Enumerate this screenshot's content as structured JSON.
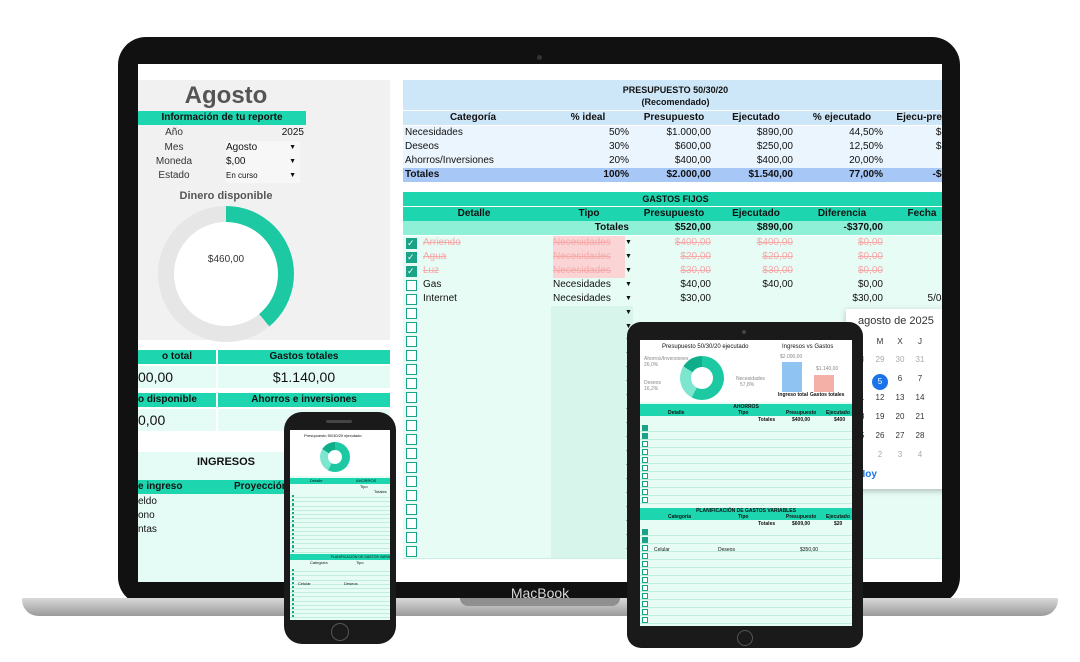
{
  "device": {
    "laptop_label": "MacBook"
  },
  "summary": {
    "month": "Agosto",
    "info_title": "Información de tu reporte",
    "fields": [
      {
        "label": "Año",
        "value": "2025"
      },
      {
        "label": "Mes",
        "value": "Agosto"
      },
      {
        "label": "Moneda",
        "value": "$,00"
      },
      {
        "label": "Estado",
        "value": "En curso"
      }
    ],
    "dinero_title": "Dinero disponible",
    "dinero_value": "$460,00",
    "dinero_fraction": 0.39,
    "kpis": [
      {
        "label": "o total",
        "value": "00,00"
      },
      {
        "label": "Gastos totales",
        "value": "$1.140,00"
      },
      {
        "label": "o disponible",
        "value": "0,00"
      },
      {
        "label": "Ahorros e inversiones",
        "value": "$"
      }
    ]
  },
  "ingresos": {
    "title": "INGRESOS",
    "col1": "e ingreso",
    "col2": "Proyección",
    "rows": [
      "eldo",
      "ono",
      "ntas"
    ]
  },
  "presupuesto": {
    "title": "PRESUPUESTO 50/30/20",
    "subtitle": "(Recomendado)",
    "headers": [
      "Categoría",
      "% ideal",
      "Presupuesto",
      "Ejecutado",
      "% ejecutado",
      "Ejecu-pres"
    ],
    "rows": [
      {
        "cat": "Necesidades",
        "ideal": "50%",
        "pres": "$1.000,00",
        "ejec": "$890,00",
        "pct": "44,50%",
        "diff": "$1"
      },
      {
        "cat": "Deseos",
        "ideal": "30%",
        "pres": "$600,00",
        "ejec": "$250,00",
        "pct": "12,50%",
        "diff": "$3"
      },
      {
        "cat": "Ahorros/Inversiones",
        "ideal": "20%",
        "pres": "$400,00",
        "ejec": "$400,00",
        "pct": "20,00%",
        "diff": ""
      }
    ],
    "totals": {
      "cat": "Totales",
      "ideal": "100%",
      "pres": "$2.000,00",
      "ejec": "$1.540,00",
      "pct": "77,00%",
      "diff": "-$4"
    }
  },
  "gastos_fijos": {
    "title": "GASTOS FIJOS",
    "headers": [
      "Detalle",
      "Tipo",
      "Presupuesto",
      "Ejecutado",
      "Diferencia",
      "Fecha"
    ],
    "totals": {
      "label": "Totales",
      "pres": "$520,00",
      "ejec": "$890,00",
      "diff": "-$370,00"
    },
    "rows": [
      {
        "checked": true,
        "detalle": "Arriendo",
        "tipo": "Necesidades",
        "pres": "$400,00",
        "ejec": "$400,00",
        "diff": "$0,00",
        "fecha": ""
      },
      {
        "checked": true,
        "detalle": "Agua",
        "tipo": "Necesidades",
        "pres": "$20,00",
        "ejec": "$20,00",
        "diff": "$0,00",
        "fecha": ""
      },
      {
        "checked": true,
        "detalle": "Luz",
        "tipo": "Necesidades",
        "pres": "$30,00",
        "ejec": "$30,00",
        "diff": "$0,00",
        "fecha": ""
      },
      {
        "checked": false,
        "detalle": "Gas",
        "tipo": "Necesidades",
        "pres": "$40,00",
        "ejec": "$40,00",
        "diff": "$0,00",
        "fecha": ""
      },
      {
        "checked": false,
        "detalle": "Internet",
        "tipo": "Necesidades",
        "pres": "$30,00",
        "ejec": "",
        "diff": "$30,00",
        "fecha": "5/08"
      }
    ],
    "right_values": [
      "0,00",
      "0,00",
      "0,00",
      "0,00",
      "0,00"
    ]
  },
  "calendar": {
    "title": "agosto de 2025",
    "weekdays": [
      "L",
      "M",
      "X",
      "J"
    ],
    "weeks": [
      [
        "28",
        "29",
        "30",
        "31"
      ],
      [
        "4",
        "5",
        "6",
        "7"
      ],
      [
        "11",
        "12",
        "13",
        "14"
      ],
      [
        "18",
        "19",
        "20",
        "21"
      ],
      [
        "25",
        "26",
        "27",
        "28"
      ],
      [
        "1",
        "2",
        "3",
        "4"
      ]
    ],
    "selected": "5",
    "today_label": "Hoy"
  },
  "tablet": {
    "chart1_title": "Presupuesto 50/30/20 ejecutado",
    "chart2_title": "Ingresos vs Gastos",
    "legend": [
      "Ahorros/Inversiones",
      "26,0%",
      "Deseos",
      "16,2%",
      "Necesidades",
      "57,8%"
    ],
    "bar_labels": [
      "Ingreso total",
      "Gastos totales"
    ],
    "bar_values": [
      "$2.000,00",
      "$1.140,00"
    ],
    "ahorros_title": "AHORROS",
    "ahorros_headers": [
      "Detalle",
      "Tipo",
      "Presupuesto",
      "Ejecutado"
    ],
    "ahorros_totals": {
      "label": "Totales",
      "pres": "$400,00",
      "ejec": "$400"
    },
    "plan_title": "PLANIFICACIÓN DE GASTOS VARIABLES",
    "plan_headers": [
      "Categoría",
      "Tipo",
      "Presupuesto",
      "Ejecutado"
    ],
    "plan_totals": {
      "label": "Totales",
      "pres": "$609,00",
      "ejec": "$20"
    },
    "plan_row": {
      "cat": "Celular",
      "tipo": "Deseos",
      "pres": "$350,00"
    }
  },
  "phone": {
    "chart_title": "Presupuesto 50/30/20 ejecutado",
    "headers": [
      "Detalle",
      "AHORROS",
      "Tipo",
      "Totales"
    ],
    "plan_title": "PLANIFICACIÓN DE GASTOS VARIA",
    "plan_headers": [
      "Categoría",
      "Tipo"
    ],
    "row": {
      "cat": "Celular",
      "tipo": "Deseos"
    }
  },
  "colors": {
    "accent": "#1dd6b0",
    "blue_header": "#cde6f8",
    "total_blue": "#a7c8f6",
    "selected": "#1a73e8"
  }
}
